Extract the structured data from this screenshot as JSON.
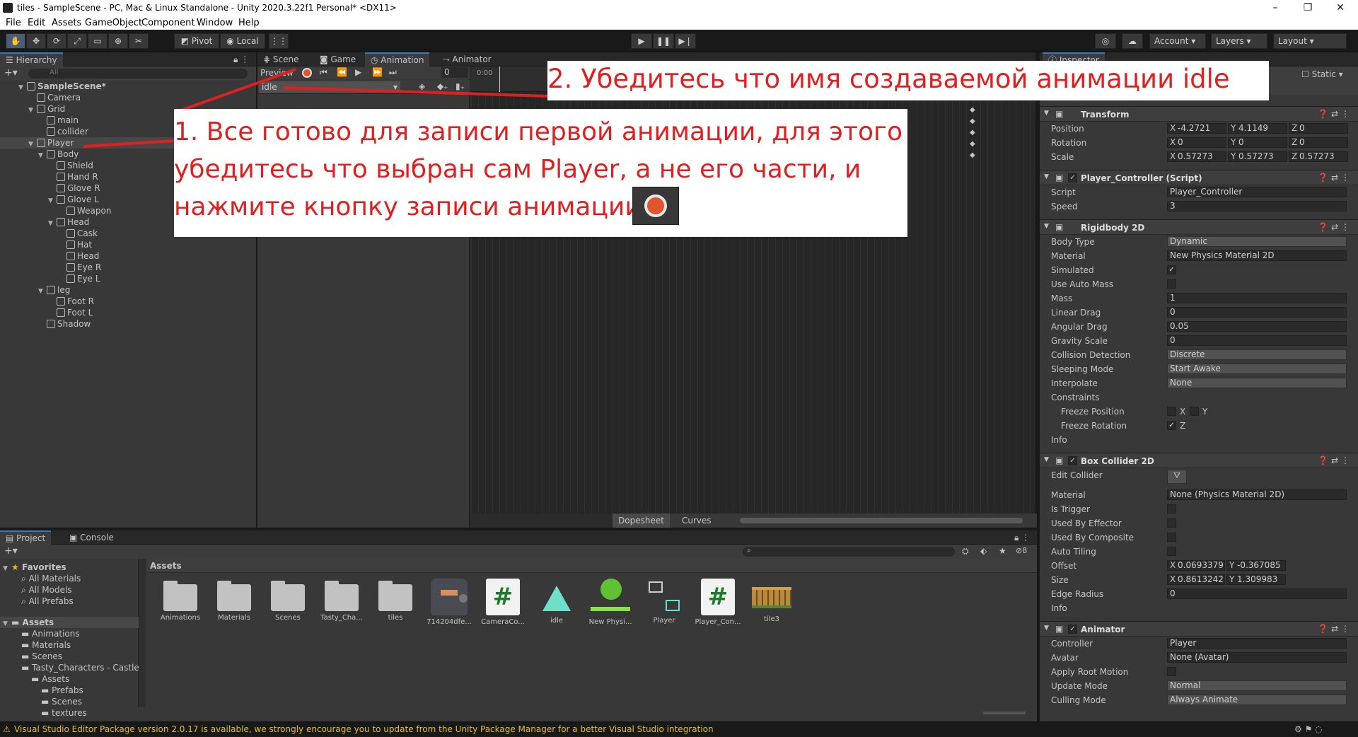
{
  "window": {
    "title": "tiles - SampleScene - PC, Mac & Linux Standalone - Unity 2020.3.22f1 Personal* <DX11>",
    "controls": [
      "–",
      "❐",
      "✕"
    ]
  },
  "menu": [
    "File",
    "Edit",
    "Assets",
    "GameObject",
    "Component",
    "Window",
    "Help"
  ],
  "toolbar": {
    "pivot": "Pivot",
    "local": "Local",
    "account": "Account",
    "layers": "Layers",
    "layout": "Layout"
  },
  "hierarchy": {
    "tab": "Hierarchy",
    "search_placeholder": "All",
    "items": [
      {
        "label": "SampleScene*",
        "depth": 0,
        "expanded": true,
        "scene": true
      },
      {
        "label": "Camera",
        "depth": 1
      },
      {
        "label": "Grid",
        "depth": 1,
        "expanded": true
      },
      {
        "label": "main",
        "depth": 2
      },
      {
        "label": "collider",
        "depth": 2
      },
      {
        "label": "Player",
        "depth": 1,
        "expanded": true,
        "selected": true
      },
      {
        "label": "Body",
        "depth": 2,
        "expanded": true
      },
      {
        "label": "Shield",
        "depth": 3
      },
      {
        "label": "Hand R",
        "depth": 3
      },
      {
        "label": "Glove R",
        "depth": 3
      },
      {
        "label": "Glove L",
        "depth": 3,
        "expanded": true
      },
      {
        "label": "Weapon",
        "depth": 4
      },
      {
        "label": "Head",
        "depth": 3,
        "expanded": true
      },
      {
        "label": "Cask",
        "depth": 4
      },
      {
        "label": "Hat",
        "depth": 4
      },
      {
        "label": "Head",
        "depth": 4
      },
      {
        "label": "Eye R",
        "depth": 4
      },
      {
        "label": "Eye L",
        "depth": 4
      },
      {
        "label": "leg",
        "depth": 2,
        "expanded": true
      },
      {
        "label": "Foot R",
        "depth": 3
      },
      {
        "label": "Foot L",
        "depth": 3
      },
      {
        "label": "Shadow",
        "depth": 2
      }
    ]
  },
  "center_tabs": [
    "Scene",
    "Game",
    "Animation",
    "Animator"
  ],
  "animation": {
    "preview": "Preview",
    "frame": "0",
    "clip": "idle",
    "time_start": "0:00",
    "dopesheet": "Dopesheet",
    "curves": "Curves"
  },
  "inspector": {
    "tab": "Inspector",
    "static": "Static",
    "transform": {
      "name": "Transform",
      "position": {
        "label": "Position",
        "x": "-4.2721",
        "y": "4.1149",
        "z": "0"
      },
      "rotation": {
        "label": "Rotation",
        "x": "0",
        "y": "0",
        "z": "0"
      },
      "scale": {
        "label": "Scale",
        "x": "0.57273",
        "y": "0.57273",
        "z": "0.57273"
      }
    },
    "script_comp": {
      "name": "Player_Controller (Script)",
      "script_label": "Script",
      "script_value": "Player_Controller",
      "speed_label": "Speed",
      "speed_value": "3"
    },
    "rigidbody": {
      "name": "Rigidbody 2D",
      "rows": [
        {
          "label": "Body Type",
          "value": "Dynamic",
          "kind": "dd"
        },
        {
          "label": "Material",
          "value": "New Physics Material 2D",
          "kind": "obj"
        },
        {
          "label": "Simulated",
          "value": "✓",
          "kind": "cb"
        },
        {
          "label": "Use Auto Mass",
          "value": "",
          "kind": "cb"
        },
        {
          "label": "Mass",
          "value": "1",
          "kind": "val"
        },
        {
          "label": "Linear Drag",
          "value": "0",
          "kind": "val"
        },
        {
          "label": "Angular Drag",
          "value": "0.05",
          "kind": "val"
        },
        {
          "label": "Gravity Scale",
          "value": "0",
          "kind": "val"
        },
        {
          "label": "Collision Detection",
          "value": "Discrete",
          "kind": "dd"
        },
        {
          "label": "Sleeping Mode",
          "value": "Start Awake",
          "kind": "dd"
        },
        {
          "label": "Interpolate",
          "value": "None",
          "kind": "dd"
        }
      ],
      "constraints": "Constraints",
      "freeze_position": "Freeze Position",
      "freeze_rotation": "Freeze Rotation",
      "x": "X",
      "y": "Y",
      "z": "Z",
      "info": "Info"
    },
    "box_collider": {
      "name": "Box Collider 2D",
      "edit_collider": "Edit Collider",
      "material_label": "Material",
      "material_value": "None (Physics Material 2D)",
      "is_trigger": "Is Trigger",
      "used_by_effector": "Used By Effector",
      "used_by_composite": "Used By Composite",
      "auto_tiling": "Auto Tiling",
      "offset_label": "Offset",
      "offset_x": "0.0693379",
      "offset_y": "-0.367085",
      "size_label": "Size",
      "size_x": "0.8613242",
      "size_y": "1.309983",
      "edge_radius_label": "Edge Radius",
      "edge_radius": "0",
      "info": "Info"
    },
    "animator": {
      "name": "Animator",
      "controller_label": "Controller",
      "controller_value": "Player",
      "avatar_label": "Avatar",
      "avatar_value": "None (Avatar)",
      "apply_root_motion": "Apply Root Motion",
      "update_mode_label": "Update Mode",
      "update_mode": "Normal",
      "culling_mode_label": "Culling Mode",
      "culling_mode": "Always Animate"
    }
  },
  "project": {
    "tabs": [
      "Project",
      "Console"
    ],
    "favorites": "Favorites",
    "fav_items": [
      "All Materials",
      "All Models",
      "All Prefabs"
    ],
    "assets_root": "Assets",
    "tree": [
      {
        "label": "Animations",
        "depth": 1
      },
      {
        "label": "Materials",
        "depth": 1
      },
      {
        "label": "Scenes",
        "depth": 1
      },
      {
        "label": "Tasty_Characters - Castle",
        "depth": 1
      },
      {
        "label": "Assets",
        "depth": 2
      },
      {
        "label": "Prefabs",
        "depth": 3
      },
      {
        "label": "Scenes",
        "depth": 3
      },
      {
        "label": "textures",
        "depth": 3
      }
    ],
    "breadcrumb": "Assets",
    "hidden_count": "8",
    "assets": [
      {
        "label": "Animations",
        "kind": "folder"
      },
      {
        "label": "Materials",
        "kind": "folder"
      },
      {
        "label": "Scenes",
        "kind": "folder"
      },
      {
        "label": "Tasty_Cha...",
        "kind": "folder"
      },
      {
        "label": "tiles",
        "kind": "folder"
      },
      {
        "label": "714204dfe...",
        "kind": "sprite"
      },
      {
        "label": "CameraCo...",
        "kind": "script"
      },
      {
        "label": "idle",
        "kind": "anim"
      },
      {
        "label": "New Physi...",
        "kind": "physmat"
      },
      {
        "label": "Player",
        "kind": "controller"
      },
      {
        "label": "Player_Con...",
        "kind": "script"
      },
      {
        "label": "tile3",
        "kind": "tiles"
      }
    ]
  },
  "status": "Visual Studio Editor Package version 2.0.17 is available, we strongly encourage you to update from the Unity Package Manager for a better Visual Studio integration",
  "annotations": {
    "note1": "1. Все готово для записи первой анимации, для этого убедитесь что выбран сам Player, а не его части, и нажмите кнопку записи анимации.",
    "note1_lines": [
      "1. Все готово для записи первой анимации, для этого",
      "убедитесь что выбран сам Player, а не его части, и",
      "нажмите кнопку записи анимации."
    ],
    "note2": "2. Убедитесь что имя создаваемой анимации idle",
    "color": "#e02020"
  }
}
